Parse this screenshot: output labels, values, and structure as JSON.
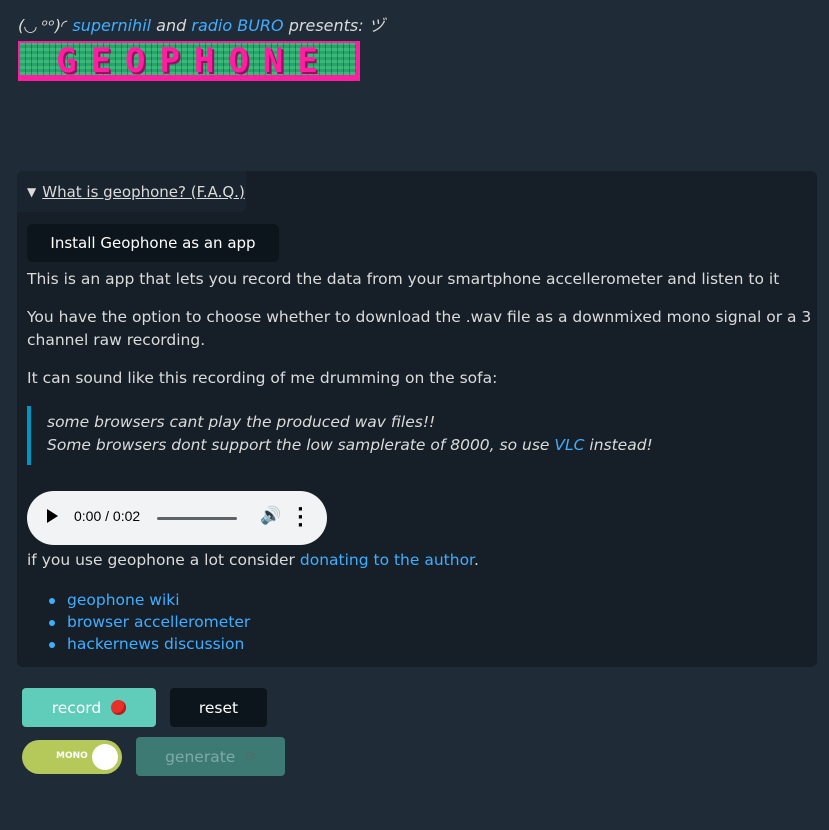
{
  "header": {
    "face": "(◡ ᵒᵒ)◜",
    "author1": "supernihil",
    "and_text": "and",
    "author2": "radio BURO",
    "presents": "presents: ヅ"
  },
  "logo": {
    "text": "GEOPHONE"
  },
  "faq": {
    "summary": "What is geophone? (F.A.Q.)",
    "install_button": "Install Geophone as an app",
    "para1": "This is an app that lets you record the data from your smartphone accellerometer and listen to it",
    "para2": "You have the option to choose whether to download the .wav file as a downmixed mono signal or a 3 channel raw recording.",
    "para3": "It can sound like this recording of me drumming on the sofa:",
    "quote_line1": "some browsers cant play the produced wav files!!",
    "quote_line2_pre": "Some browsers dont support the low samplerate of 8000, so use",
    "quote_link": "VLC",
    "quote_line2_post": "instead!",
    "audio_time": "0:00 / 0:02",
    "donate_pre": "if you use geophone a lot consider",
    "donate_link": "donating to the author",
    "donate_post": ".",
    "links": [
      "geophone wiki",
      "browser accellerometer",
      "hackernews discussion"
    ]
  },
  "controls": {
    "record_label": "record",
    "reset_label": "reset",
    "toggle_label": "MONO",
    "generate_label": "generate",
    "generate_icon": "⚙"
  },
  "colors": {
    "background": "#202b38",
    "panel": "#161f27",
    "link": "#41adff",
    "record_button": "#5fcdb9",
    "toggle": "#b5c95a",
    "generate_button": "#3e7a74",
    "logo_pink": "#ff1fa0",
    "logo_green": "#3cb97a"
  }
}
